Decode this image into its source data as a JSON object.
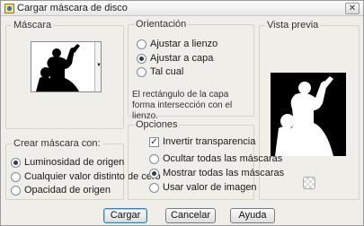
{
  "window": {
    "title": "Cargar máscara de disco",
    "close_label": "✕"
  },
  "mask": {
    "legend": "Máscara"
  },
  "orientation": {
    "legend": "Orientación",
    "options": [
      "Ajustar a lienzo",
      "Ajustar a capa",
      "Tal cual"
    ],
    "selected": 1,
    "description": "El rectángulo de la capa forma intersección con el lienzo."
  },
  "preview": {
    "legend": "Vista previa"
  },
  "create_mask": {
    "legend": "Crear máscara con:",
    "options": [
      "Luminosidad de origen",
      "Cualquier valor distinto de cero",
      "Opacidad de origen"
    ],
    "selected": 0
  },
  "options": {
    "legend": "Opciones",
    "invert_label": "Invertir transparencia",
    "invert_checked": true,
    "radios": [
      "Ocultar todas las máscaras",
      "Mostrar todas las máscaras",
      "Usar valor de imagen"
    ],
    "selected": 1
  },
  "buttons": {
    "load": "Cargar",
    "cancel": "Cancelar",
    "help": "Ayuda"
  }
}
